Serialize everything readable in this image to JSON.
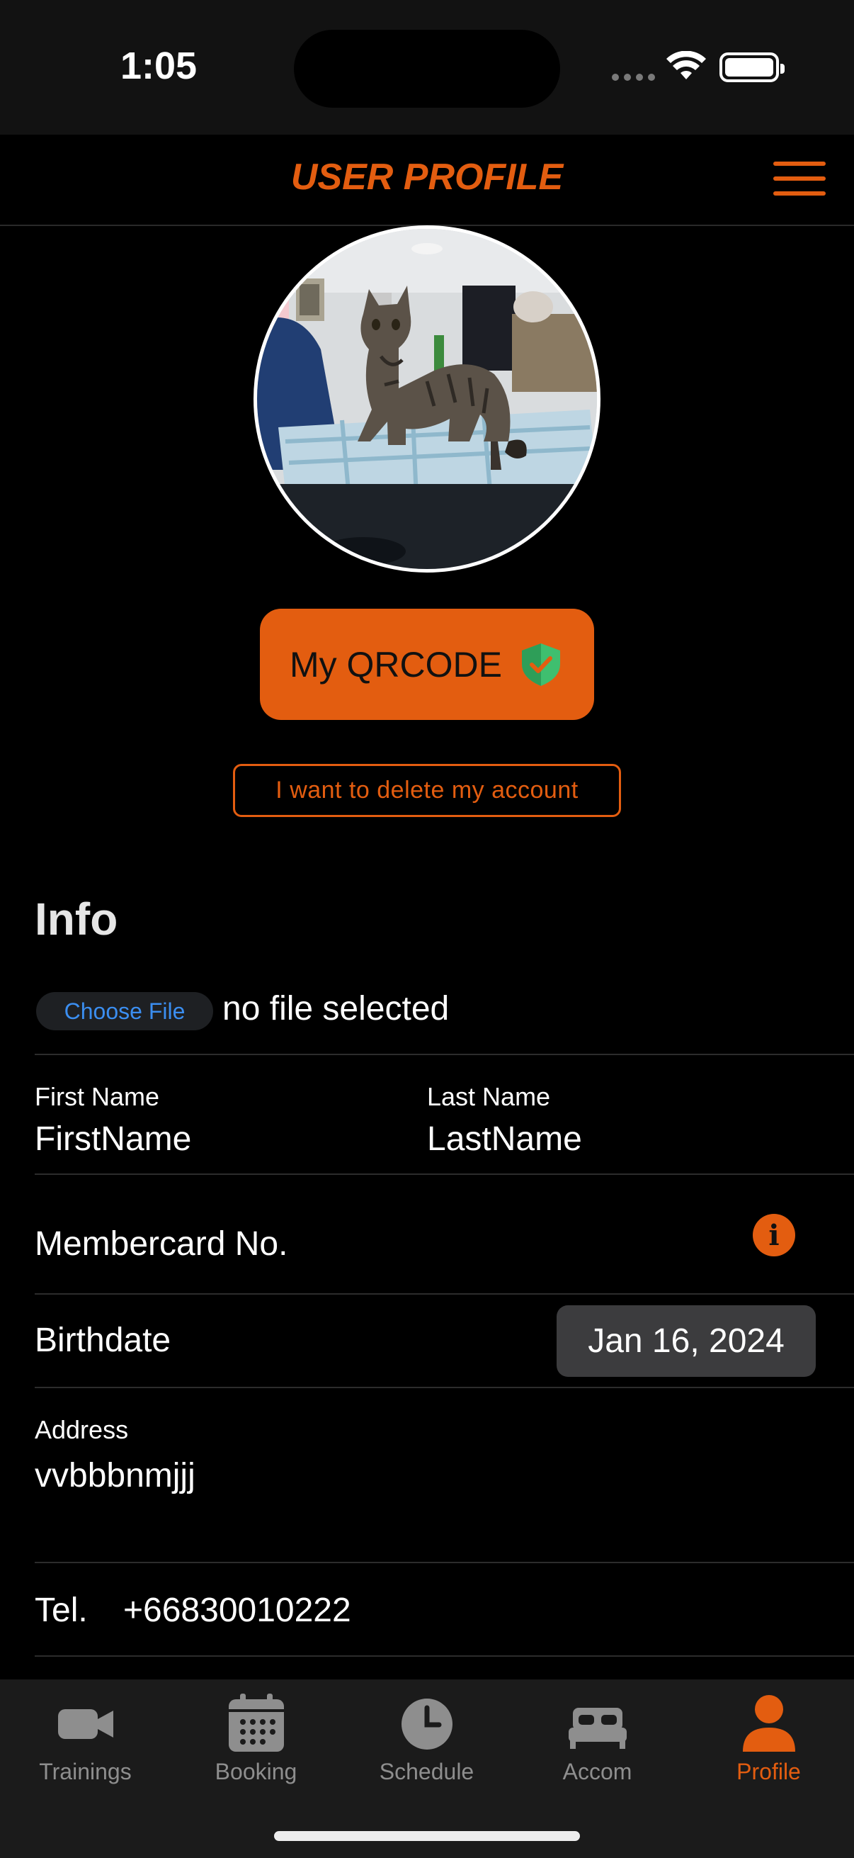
{
  "status_bar": {
    "time": "1:05"
  },
  "header": {
    "title": "USER PROFILE"
  },
  "profile": {
    "qr_button_label": "My QRCODE",
    "delete_account_label": "I want to delete my account"
  },
  "info": {
    "section_title": "Info",
    "file_button_label": "Choose File",
    "file_status": "no file selected",
    "first_name_label": "First Name",
    "first_name_value": "FirstName",
    "last_name_label": "Last Name",
    "last_name_value": "LastName",
    "membercard_label": "Membercard No.",
    "birthdate_label": "Birthdate",
    "birthdate_value": "Jan 16, 2024",
    "address_label": "Address",
    "address_value": "vvbbbnmjjj",
    "tel_label": "Tel.",
    "tel_value": "+66830010222"
  },
  "tabs": [
    {
      "label": "Trainings",
      "icon": "video-camera-icon"
    },
    {
      "label": "Booking",
      "icon": "calendar-icon"
    },
    {
      "label": "Schedule",
      "icon": "clock-icon"
    },
    {
      "label": "Accom",
      "icon": "bed-icon"
    },
    {
      "label": "Profile",
      "icon": "person-icon",
      "active": true
    }
  ],
  "colors": {
    "accent": "#e35d10",
    "background": "#000000",
    "header_bg": "#121212",
    "tab_inactive": "#8e8e8e",
    "shield": "#3fbf6f",
    "link_blue": "#3b8ef0"
  }
}
